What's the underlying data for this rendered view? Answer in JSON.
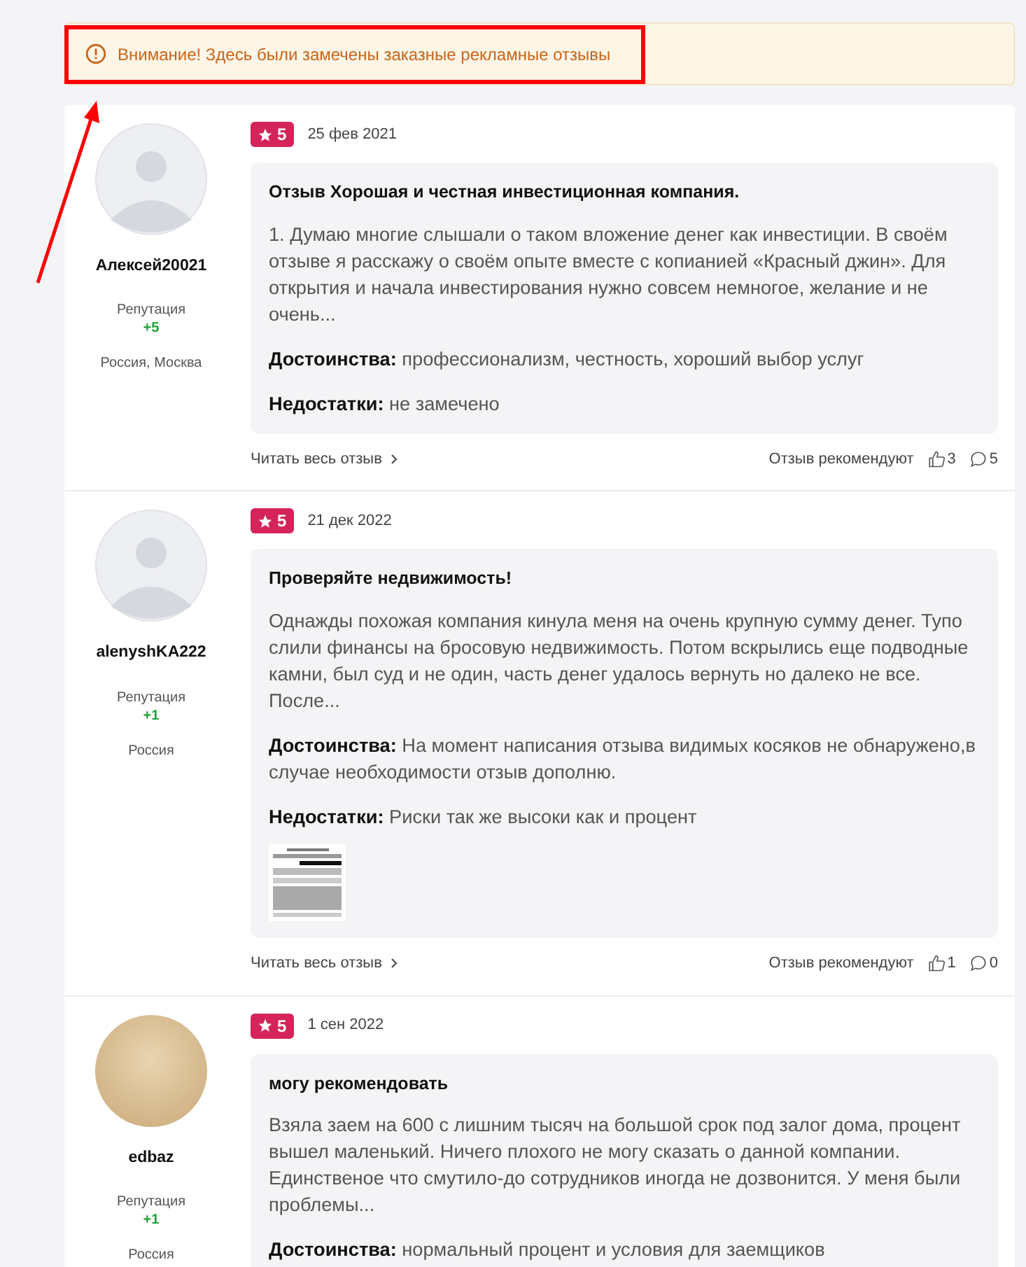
{
  "alert": {
    "text": "Внимание! Здесь были замечены заказные рекламные отзывы"
  },
  "reviews": [
    {
      "author": "Алексей20021",
      "avatar": {
        "kind": "placeholder"
      },
      "reputation_label": "Репутация",
      "reputation": "+5",
      "location": "Россия, Москва",
      "rating": "5",
      "date": "25 фев 2021",
      "title": "Отзыв Хорошая и честная инвестиционная компания.",
      "text": "1. Думаю многие слышали о таком вложение денег как инвестиции. В своём отзыве я расскажу о своём опыте вместе с копианией «Красный джин». Для открытия и начала инвестирования нужно совсем немногое, желание и не очень...",
      "pros_label": "Достоинства:",
      "pros": "профессионализм, честность, хороший выбор услуг",
      "cons_label": "Недостатки:",
      "cons": "не замечено",
      "attachment": false,
      "read_more": "Читать весь отзыв",
      "recommend_label": "Отзыв рекомендуют",
      "likes": "3",
      "comments": "5"
    },
    {
      "author": "alenyshKA222",
      "avatar": {
        "kind": "placeholder"
      },
      "reputation_label": "Репутация",
      "reputation": "+1",
      "location": "Россия",
      "rating": "5",
      "date": "21 дек 2022",
      "title": "Проверяйте недвижимость!",
      "text": "Однажды похожая компания кинула меня на очень крупную сумму денег. Тупо слили финансы на бросовую недвижимость. Потом вскрылись еще подводные камни, был суд и не один, часть денег удалось вернуть но далеко не все. После...",
      "pros_label": "Достоинства:",
      "pros": "На момент написания отзыва видимых косяков не обнаружено,в случае необходимости отзыв дополню.",
      "cons_label": "Недостатки:",
      "cons": "Риски так же высоки как и процент",
      "attachment": true,
      "read_more": "Читать весь отзыв",
      "recommend_label": "Отзыв рекомендуют",
      "likes": "1",
      "comments": "0"
    },
    {
      "author": "edbaz",
      "avatar": {
        "kind": "photo"
      },
      "reputation_label": "Репутация",
      "reputation": "+1",
      "location": "Россия",
      "rating": "5",
      "date": "1 сен 2022",
      "title": "могу рекомендовать",
      "text": "Взяла заем на 600 с лишним тысяч на большой срок под залог дома, процент вышел маленький. Ничего плохого не могу сказать о данной компании. Единственое что смутило-до сотрудников иногда не дозвонится. У меня были проблемы...",
      "pros_label": "Достоинства:",
      "pros": "нормальный процент и условия для заемщиков",
      "attachment": false
    }
  ]
}
